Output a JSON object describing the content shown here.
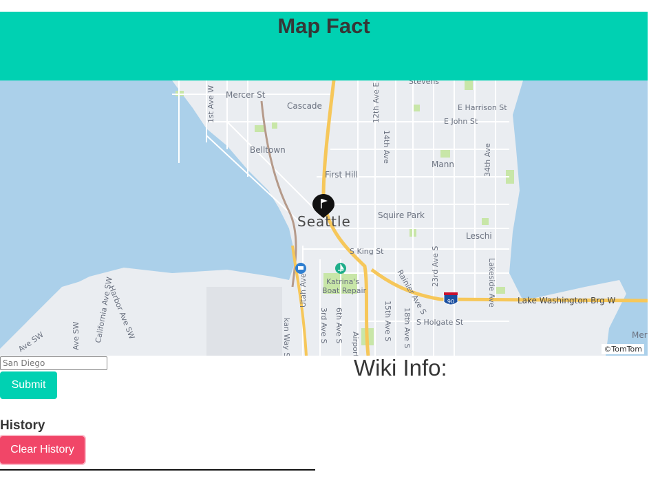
{
  "header": {
    "title": "Map Fact"
  },
  "map": {
    "city_label": "Seattle",
    "attribution": "©TomTom",
    "labels": {
      "mercer": "Mercer St",
      "cascade": "Cascade",
      "belltown": "Belltown",
      "firsthill": "First Hill",
      "squirepark": "Squire Park",
      "mann": "Mann",
      "leschi": "Leschi",
      "stevens": "Stevens",
      "eharrison": "E Harrison St",
      "ejohn": "E John St",
      "sking": "S King St",
      "katrina1": "Katrina's",
      "katrina2": "Boat Repair",
      "shgate": "S Holgate St",
      "lakewash": "Lake Washington Brg W",
      "ave1": "1st Ave W",
      "ave12": "12th Ave E",
      "ave14": "14th Ave",
      "ave34": "34th Ave",
      "ave23": "23rd Ave S",
      "rainier": "Rainier Ave S",
      "ave15": "15th Ave S",
      "ave18": "18th Ave S",
      "utah": "Utah Ave S",
      "ave3": "3rd Ave S",
      "ave6": "6th Ave S",
      "airport": "Airport",
      "lakeside": "Lakeside Ave",
      "harbor": "Harbor Ave SW",
      "california": "California Ave SW",
      "avesw": "Ave SW",
      "avesw2": "Ave SW",
      "kanway": "kan Way S",
      "mer": "Mer",
      "hwy": "90"
    },
    "colors": {
      "water": "#abd0ea",
      "land": "#eaedf1",
      "park": "#c8e6a8",
      "highway": "#f6c75a"
    }
  },
  "search": {
    "placeholder": "San Diego",
    "value": ""
  },
  "submit_label": "Submit",
  "history": {
    "title": "History",
    "clear_label": "Clear History",
    "items": []
  },
  "wiki": {
    "title": "Wiki Info:"
  }
}
